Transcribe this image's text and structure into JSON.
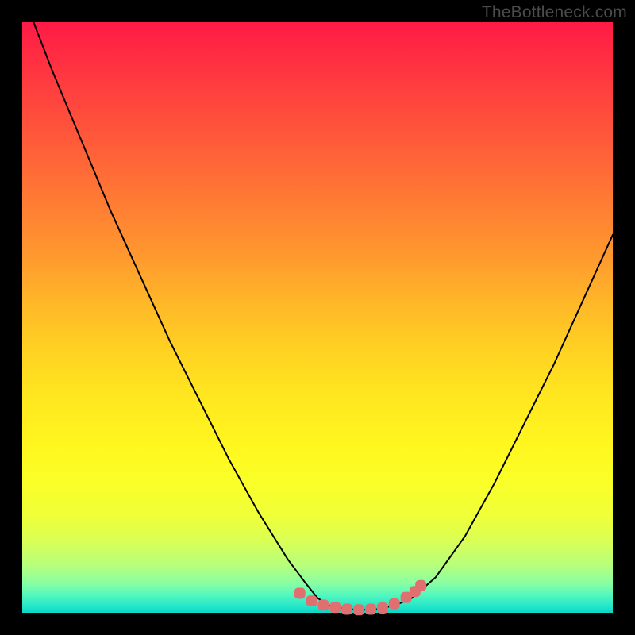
{
  "watermark": "TheBottleneck.com",
  "colors": {
    "frame": "#000000",
    "curve_stroke": "#000000",
    "marker_fill": "#e07070",
    "gradient_top": "#ff1a46",
    "gradient_bottom": "#0fd8c9"
  },
  "chart_data": {
    "type": "line",
    "title": "",
    "xlabel": "",
    "ylabel": "",
    "xlim": [
      0,
      100
    ],
    "ylim": [
      0,
      100
    ],
    "series": [
      {
        "name": "curve",
        "x": [
          0,
          5,
          10,
          15,
          20,
          25,
          30,
          35,
          40,
          45,
          48,
          50,
          52,
          55,
          58,
          60,
          63,
          66,
          70,
          75,
          80,
          85,
          90,
          95,
          100
        ],
        "y": [
          105,
          92,
          80,
          68,
          57,
          46,
          36,
          26,
          17,
          9,
          5,
          2.5,
          1.2,
          0.6,
          0.5,
          0.6,
          1.2,
          2.5,
          6,
          13,
          22,
          32,
          42,
          53,
          64
        ]
      }
    ],
    "markers": {
      "name": "bottom-markers",
      "x": [
        47,
        49,
        51,
        53,
        55,
        57,
        59,
        61,
        63,
        65,
        66.5,
        67.5
      ],
      "y": [
        3.3,
        2.0,
        1.3,
        0.9,
        0.6,
        0.5,
        0.6,
        0.8,
        1.5,
        2.6,
        3.6,
        4.6
      ]
    }
  }
}
